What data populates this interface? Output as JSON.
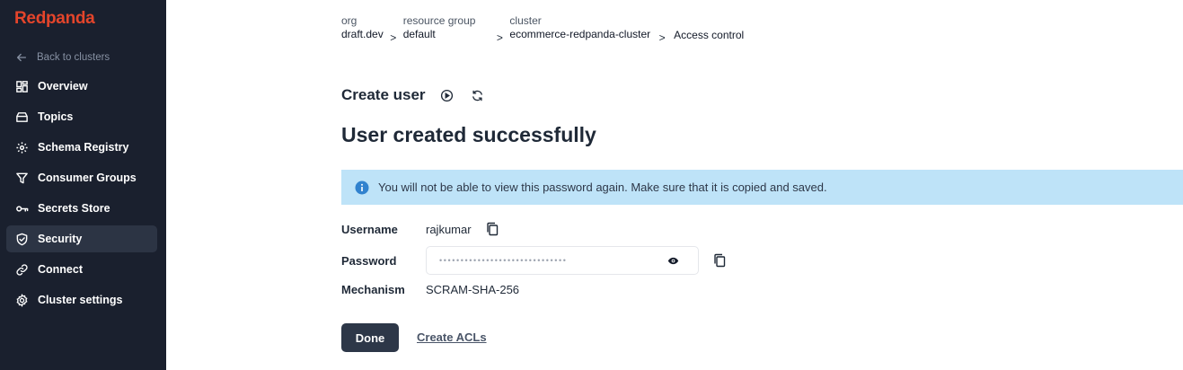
{
  "app": {
    "logo": "Redpanda"
  },
  "sidebar": {
    "back_label": "Back to clusters",
    "items": [
      {
        "label": "Overview",
        "icon": "grid-icon"
      },
      {
        "label": "Topics",
        "icon": "topics-icon"
      },
      {
        "label": "Schema Registry",
        "icon": "schema-icon"
      },
      {
        "label": "Consumer Groups",
        "icon": "filter-icon"
      },
      {
        "label": "Secrets Store",
        "icon": "key-icon"
      },
      {
        "label": "Security",
        "icon": "shield-icon",
        "active": true
      },
      {
        "label": "Connect",
        "icon": "link-icon"
      },
      {
        "label": "Cluster settings",
        "icon": "gear-icon"
      }
    ]
  },
  "breadcrumb": {
    "org_key": "org",
    "org_value": "draft.dev",
    "rg_key": "resource group",
    "rg_value": "default",
    "cluster_key": "cluster",
    "cluster_value": "ecommerce-redpanda-cluster",
    "current": "Access control",
    "sep": ">"
  },
  "page": {
    "section_title": "Create user",
    "success_title": "User created successfully",
    "alert_text": "You will not be able to view this password again. Make sure that it is copied and saved."
  },
  "user": {
    "username_label": "Username",
    "username": "rajkumar",
    "password_label": "Password",
    "password_masked": "••••••••••••••••••••••••••••••",
    "mechanism_label": "Mechanism",
    "mechanism": "SCRAM-SHA-256"
  },
  "actions": {
    "done_label": "Done",
    "create_acls_label": "Create ACLs"
  },
  "colors": {
    "sidebar_bg": "#1a202e",
    "brand": "#e4452b",
    "alert_bg": "#bee3f8",
    "primary_button": "#2d3748"
  }
}
